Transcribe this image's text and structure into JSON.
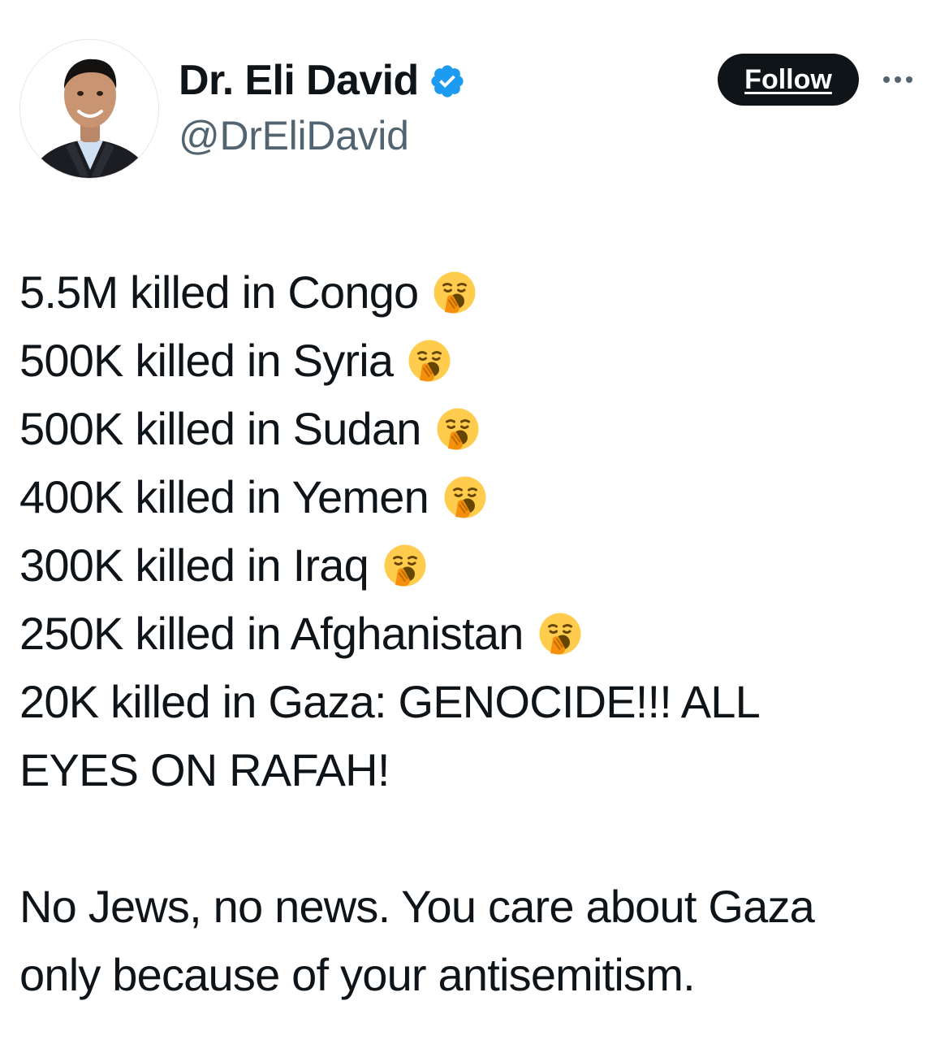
{
  "author": {
    "display_name": "Dr. Eli David",
    "handle": "@DrEliDavid",
    "verified": true
  },
  "actions": {
    "follow_label": "Follow",
    "more_icon": "more-horizontal-icon"
  },
  "tweet": {
    "lines": [
      {
        "text": "5.5M killed in Congo",
        "emoji": "yawning-face-icon"
      },
      {
        "text": "500K killed in Syria",
        "emoji": "yawning-face-icon"
      },
      {
        "text": "500K killed in Sudan",
        "emoji": "yawning-face-icon"
      },
      {
        "text": "400K killed in Yemen",
        "emoji": "yawning-face-icon"
      },
      {
        "text": "300K killed in Iraq",
        "emoji": "yawning-face-icon"
      },
      {
        "text": "250K killed in Afghanistan",
        "emoji": "yawning-face-icon"
      }
    ],
    "line_gaza_1": "20K killed in Gaza: GENOCIDE!!! ALL",
    "line_gaza_2": "EYES ON RAFAH!",
    "para_2_line_1": "No Jews, no news. You care about Gaza",
    "para_2_line_2": "only because of your antisemitism."
  },
  "colors": {
    "text": "#0f1419",
    "secondary_text": "#536471",
    "verified_blue": "#1d9bf0",
    "button_bg": "#0f1419",
    "emoji_yellow": "#ffcc4d",
    "emoji_hand": "#f4900c"
  }
}
